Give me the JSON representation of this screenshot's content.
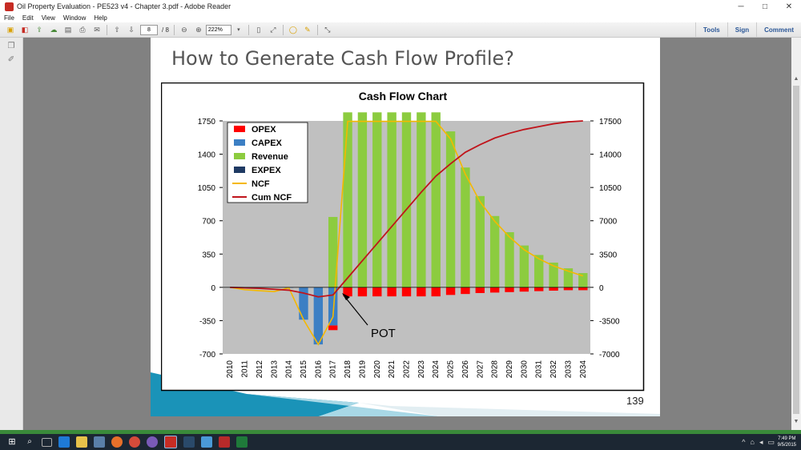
{
  "window": {
    "title": "Oil Property Evaluation - PE523 v4 - Chapter 3.pdf - Adobe Reader",
    "minimize": "─",
    "maximize": "□",
    "close": "✕"
  },
  "menu": [
    "File",
    "Edit",
    "View",
    "Window",
    "Help"
  ],
  "toolbar": {
    "page_current": "8",
    "page_total": "/ 8",
    "zoom": "222%",
    "links": [
      "Tools",
      "Sign",
      "Comment"
    ]
  },
  "slide": {
    "title": "How to Generate Cash Flow Profile?",
    "page_number": "139"
  },
  "chart_data": {
    "type": "bar",
    "title": "Cash Flow Chart",
    "categories": [
      "2010",
      "2011",
      "2012",
      "2013",
      "2014",
      "2015",
      "2016",
      "2017",
      "2018",
      "2019",
      "2020",
      "2021",
      "2022",
      "2023",
      "2024",
      "2025",
      "2026",
      "2027",
      "2028",
      "2029",
      "2030",
      "2031",
      "2032",
      "2033",
      "2034"
    ],
    "left_ticks": [
      "1750",
      "1400",
      "1050",
      "700",
      "350",
      "0",
      "-350",
      "-700"
    ],
    "right_ticks": [
      "17500",
      "14000",
      "10500",
      "7000",
      "3500",
      "0",
      "-3500",
      "-7000"
    ],
    "ylim_left": [
      -700,
      1750
    ],
    "ylim_right": [
      -7000,
      17500
    ],
    "legend": [
      {
        "name": "OPEX",
        "color": "#ff0000",
        "kind": "box"
      },
      {
        "name": "CAPEX",
        "color": "#3c7fc4",
        "kind": "box"
      },
      {
        "name": "Revenue",
        "color": "#8ccc3f",
        "kind": "box"
      },
      {
        "name": "EXPEX",
        "color": "#1f3a63",
        "kind": "box"
      },
      {
        "name": "NCF",
        "color": "#f5b800",
        "kind": "line"
      },
      {
        "name": "Cum NCF",
        "color": "#c0141b",
        "kind": "line"
      }
    ],
    "series": [
      {
        "name": "Revenue",
        "axis": "left",
        "values": [
          0,
          0,
          0,
          0,
          0,
          0,
          0,
          740,
          1840,
          1840,
          1840,
          1840,
          1840,
          1840,
          1840,
          1640,
          1260,
          960,
          750,
          580,
          440,
          340,
          260,
          200,
          150
        ]
      },
      {
        "name": "OPEX",
        "axis": "left",
        "values": [
          0,
          0,
          0,
          0,
          0,
          0,
          0,
          -50,
          -95,
          -95,
          -95,
          -95,
          -95,
          -95,
          -95,
          -80,
          -70,
          -60,
          -55,
          -50,
          -45,
          -40,
          -35,
          -30,
          -30
        ]
      },
      {
        "name": "CAPEX",
        "axis": "left",
        "values": [
          0,
          0,
          0,
          0,
          -5,
          -340,
          -600,
          -400,
          0,
          0,
          0,
          0,
          0,
          0,
          0,
          0,
          0,
          0,
          0,
          0,
          0,
          0,
          0,
          0,
          0
        ]
      },
      {
        "name": "NCF",
        "axis": "left",
        "values": [
          0,
          -25,
          -35,
          -45,
          -5,
          -340,
          -600,
          -310,
          1745,
          1745,
          1745,
          1745,
          1745,
          1745,
          1745,
          1560,
          1190,
          900,
          695,
          530,
          395,
          300,
          225,
          170,
          120
        ]
      },
      {
        "name": "Cum NCF",
        "axis": "right",
        "values": [
          0,
          -50,
          -100,
          -200,
          -300,
          -600,
          -1000,
          -800,
          1000,
          2800,
          4600,
          6400,
          8200,
          10000,
          11700,
          13000,
          14200,
          15000,
          15700,
          16200,
          16600,
          16900,
          17200,
          17400,
          17500
        ]
      }
    ],
    "annotation": {
      "text": "POT"
    }
  },
  "taskbar": {
    "clock_time": "7:49 PM",
    "clock_date": "9/5/2015"
  }
}
